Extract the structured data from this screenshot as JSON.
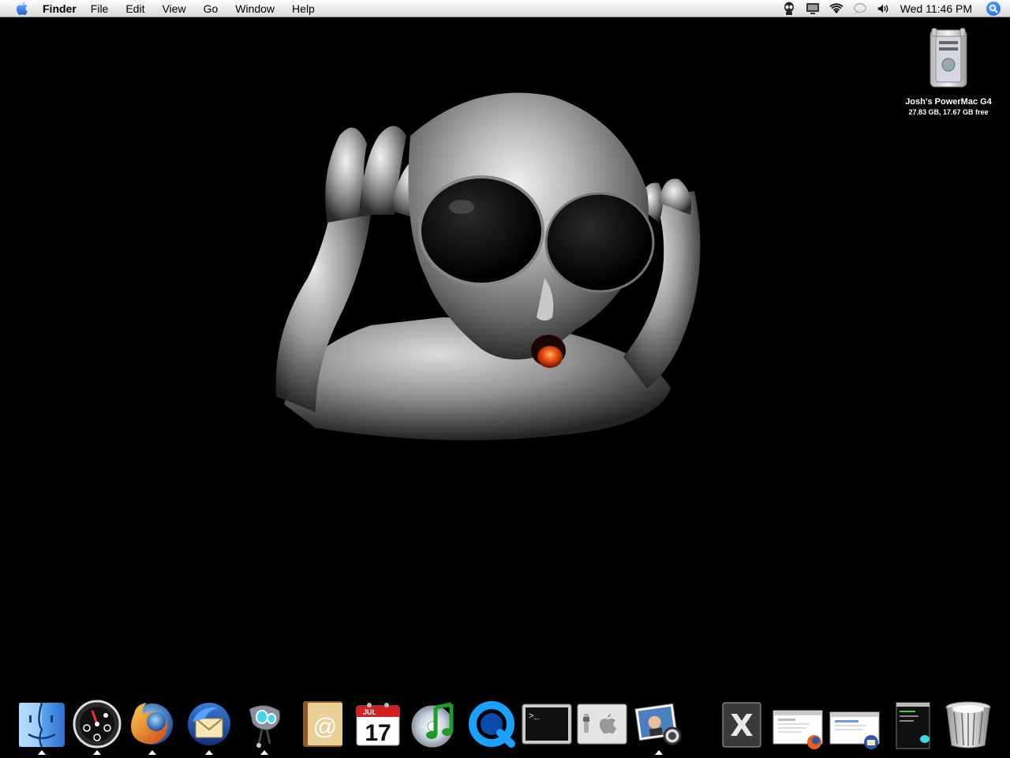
{
  "menubar": {
    "apple_icon": "apple-logo-icon",
    "app_name": "Finder",
    "items": [
      "File",
      "Edit",
      "View",
      "Go",
      "Window",
      "Help"
    ],
    "status_icons": [
      "alien-icon",
      "display-icon",
      "wifi-icon",
      "ichat-status-icon",
      "volume-icon"
    ],
    "clock": "Wed 11:46 PM",
    "spotlight_icon": "spotlight-icon"
  },
  "desktop": {
    "disk": {
      "icon": "powermac-g4-icon",
      "name": "Josh's PowerMac G4",
      "info": "27.83 GB, 17.67 GB free"
    }
  },
  "dock": {
    "items": [
      {
        "name": "Finder",
        "icon": "finder-icon",
        "running": true
      },
      {
        "name": "Dashboard",
        "icon": "dashboard-icon",
        "running": true
      },
      {
        "name": "Firefox",
        "icon": "firefox-icon",
        "running": true
      },
      {
        "name": "Thunderbird",
        "icon": "thunderbird-icon",
        "running": true
      },
      {
        "name": "Adium",
        "icon": "adium-icon",
        "running": true
      },
      {
        "name": "Address Book",
        "icon": "address-book-icon",
        "running": false
      },
      {
        "name": "iCal",
        "icon": "ical-icon",
        "running": false,
        "month": "JUL",
        "day": "17"
      },
      {
        "name": "iTunes",
        "icon": "itunes-icon",
        "running": false
      },
      {
        "name": "QuickTime Player",
        "icon": "quicktime-icon",
        "running": false
      },
      {
        "name": "Terminal",
        "icon": "terminal-icon",
        "running": false,
        "prompt": ">_"
      },
      {
        "name": "System Preferences",
        "icon": "system-preferences-icon",
        "running": false
      },
      {
        "name": "Preview",
        "icon": "preview-icon",
        "running": true
      },
      {
        "name": "X11",
        "icon": "x11-icon",
        "running": false,
        "letter": "X"
      },
      {
        "name": "Minimized Firefox window",
        "icon": "minimized-firefox-window-icon",
        "running": false
      },
      {
        "name": "Minimized Thunderbird window",
        "icon": "minimized-thunderbird-window-icon",
        "running": false
      },
      {
        "name": "Minimized Adium window",
        "icon": "minimized-adium-window-icon",
        "running": false
      },
      {
        "name": "Trash",
        "icon": "trash-icon",
        "running": false
      }
    ]
  }
}
